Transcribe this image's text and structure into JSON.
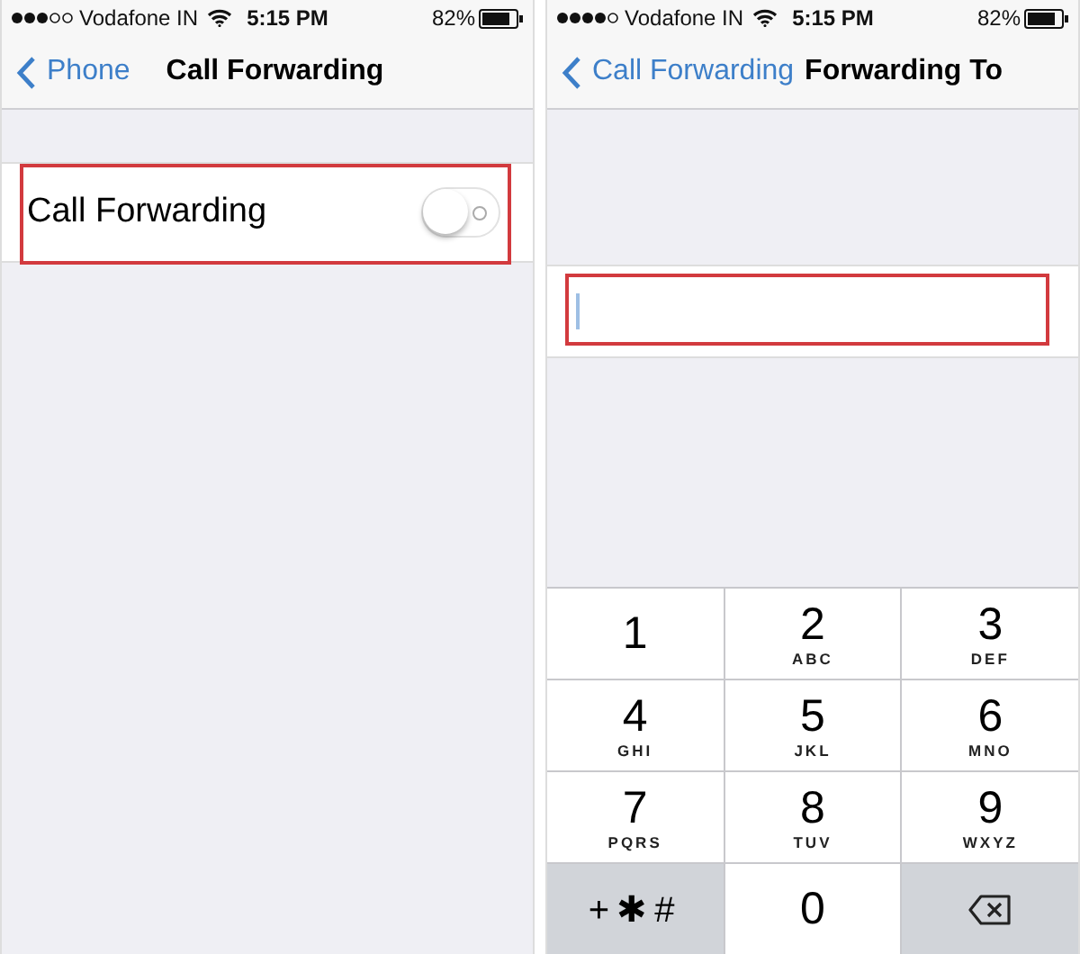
{
  "screens": [
    {
      "status_bar": {
        "carrier": "Vodafone IN",
        "time": "5:15 PM",
        "battery": "82%"
      },
      "nav": {
        "back": "Phone",
        "title": "Call Forwarding"
      },
      "cells": [
        {
          "kind": "toggle",
          "label": "Call Forwarding",
          "on": false,
          "highlighted": true
        }
      ]
    },
    {
      "status_bar": {
        "carrier": "Vodafone IN",
        "time": "5:15 PM",
        "battery": "82%"
      },
      "nav": {
        "back": "Call Forwarding",
        "title": "Forwarding To"
      },
      "cells": [
        {
          "kind": "input",
          "focused": true,
          "highlighted": true
        }
      ],
      "keypad": [
        {
          "kind": "digit",
          "digit": "1"
        },
        {
          "kind": "digit",
          "digit": "2",
          "letters": "ABC"
        },
        {
          "kind": "digit",
          "digit": "3",
          "letters": "DEF"
        },
        {
          "kind": "digit",
          "digit": "4",
          "letters": "GHI"
        },
        {
          "kind": "digit",
          "digit": "5",
          "letters": "JKL"
        },
        {
          "kind": "digit",
          "digit": "6",
          "letters": "MNO"
        },
        {
          "kind": "digit",
          "digit": "7",
          "letters": "PQRS"
        },
        {
          "kind": "digit",
          "digit": "8",
          "letters": "TUV"
        },
        {
          "kind": "digit",
          "digit": "9",
          "letters": "WXYZ"
        },
        {
          "kind": "symbols",
          "label": "+✱#"
        },
        {
          "kind": "digit",
          "digit": "0"
        },
        {
          "kind": "delete"
        }
      ]
    }
  ]
}
